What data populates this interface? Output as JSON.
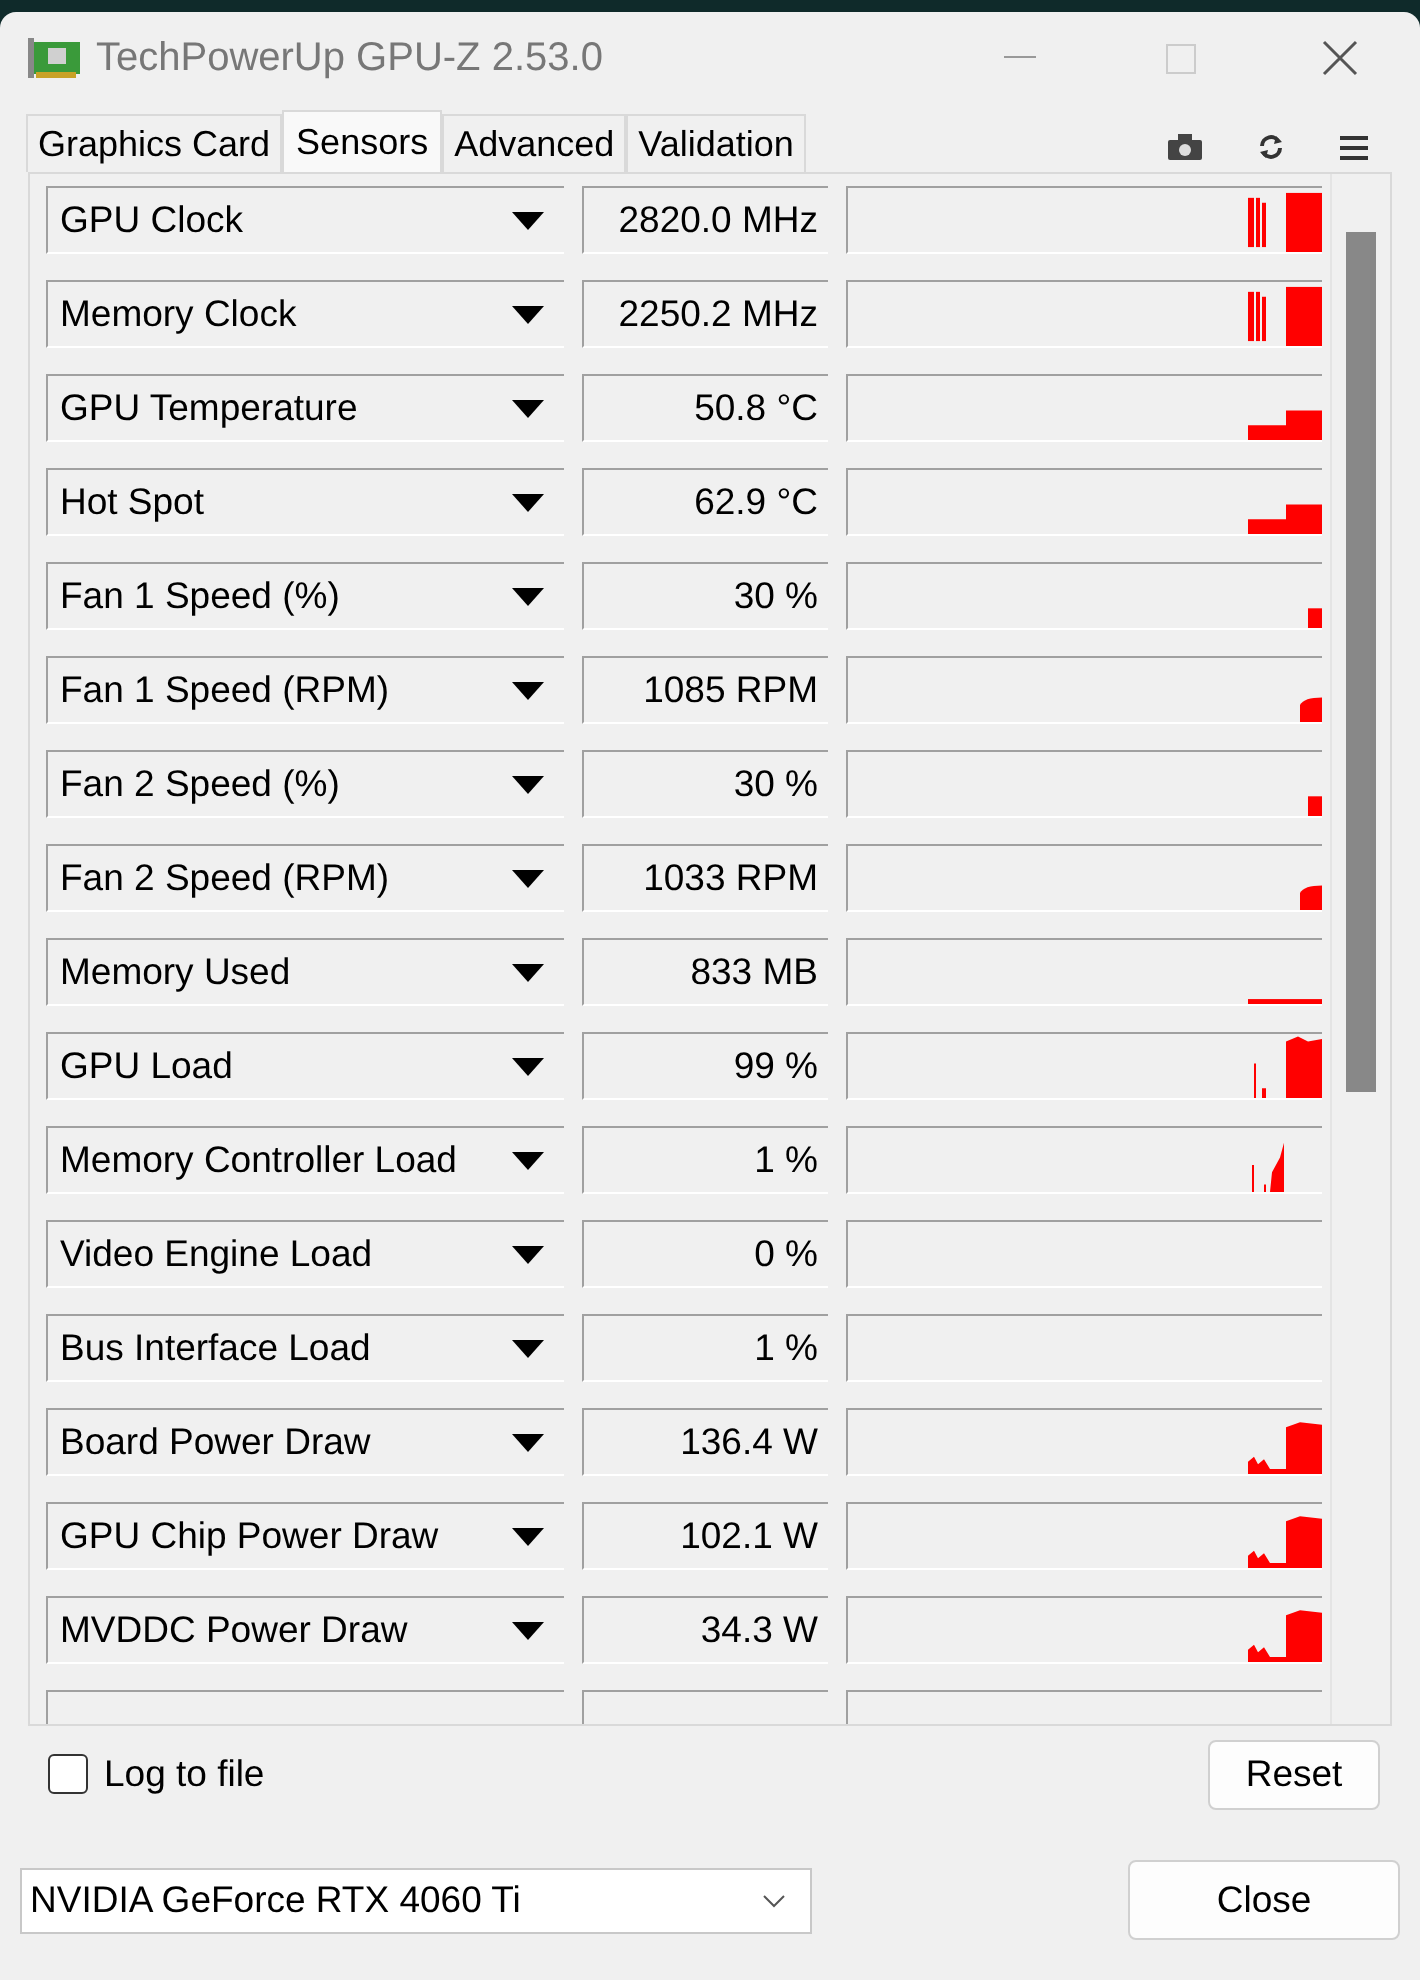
{
  "window": {
    "title": "TechPowerUp GPU-Z 2.53.0"
  },
  "tabs": [
    {
      "label": "Graphics Card",
      "selected": false
    },
    {
      "label": "Sensors",
      "selected": true
    },
    {
      "label": "Advanced",
      "selected": false
    },
    {
      "label": "Validation",
      "selected": false
    }
  ],
  "sensors": [
    {
      "name": "GPU Clock",
      "value": "2820.0 MHz",
      "kind": "spikes"
    },
    {
      "name": "Memory Clock",
      "value": "2250.2 MHz",
      "kind": "spikes"
    },
    {
      "name": "GPU Temperature",
      "value": "50.8 °C",
      "kind": "step"
    },
    {
      "name": "Hot Spot",
      "value": "62.9 °C",
      "kind": "step"
    },
    {
      "name": "Fan 1 Speed (%)",
      "value": "30 %",
      "kind": "tiny"
    },
    {
      "name": "Fan 1 Speed (RPM)",
      "value": "1085 RPM",
      "kind": "bump"
    },
    {
      "name": "Fan 2 Speed (%)",
      "value": "30 %",
      "kind": "tiny"
    },
    {
      "name": "Fan 2 Speed (RPM)",
      "value": "1033 RPM",
      "kind": "bump"
    },
    {
      "name": "Memory Used",
      "value": "833 MB",
      "kind": "line"
    },
    {
      "name": "GPU Load",
      "value": "99 %",
      "kind": "load"
    },
    {
      "name": "Memory Controller Load",
      "value": "1 %",
      "kind": "ramp"
    },
    {
      "name": "Video Engine Load",
      "value": "0 %",
      "kind": "empty"
    },
    {
      "name": "Bus Interface Load",
      "value": "1 %",
      "kind": "empty"
    },
    {
      "name": "Board Power Draw",
      "value": "136.4 W",
      "kind": "power"
    },
    {
      "name": "GPU Chip Power Draw",
      "value": "102.1 W",
      "kind": "power"
    },
    {
      "name": "MVDDC Power Draw",
      "value": "34.3 W",
      "kind": "power"
    }
  ],
  "log_to_file": {
    "label": "Log to file",
    "checked": false
  },
  "reset_button": "Reset",
  "gpu_select": {
    "value": "NVIDIA GeForce RTX 4060 Ti"
  },
  "close_button": "Close"
}
